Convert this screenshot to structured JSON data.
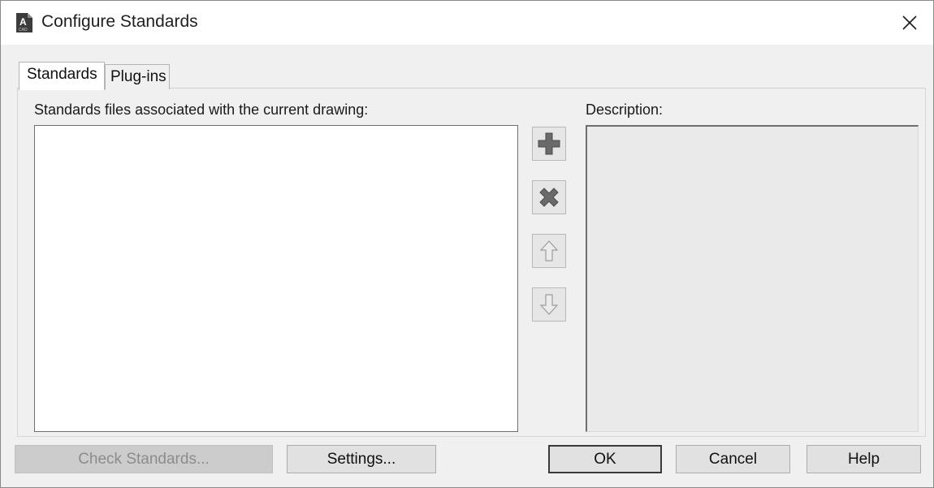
{
  "window": {
    "title": "Configure Standards",
    "icon": "autocad-app-icon",
    "icon_text": "A",
    "icon_sub": "CAD"
  },
  "tabs": [
    {
      "label": "Standards",
      "active": true
    },
    {
      "label": "Plug-ins",
      "active": false
    }
  ],
  "standards": {
    "files_label": "Standards files associated with the current drawing:",
    "files": [],
    "description_label": "Description:",
    "description": ""
  },
  "side_buttons": [
    {
      "icon": "plus-icon",
      "enabled": true
    },
    {
      "icon": "delete-x-icon",
      "enabled": true
    },
    {
      "icon": "arrow-up-icon",
      "enabled": false
    },
    {
      "icon": "arrow-down-icon",
      "enabled": false
    }
  ],
  "buttons": {
    "check_standards": "Check Standards...",
    "settings": "Settings...",
    "ok": "OK",
    "cancel": "Cancel",
    "help": "Help"
  }
}
